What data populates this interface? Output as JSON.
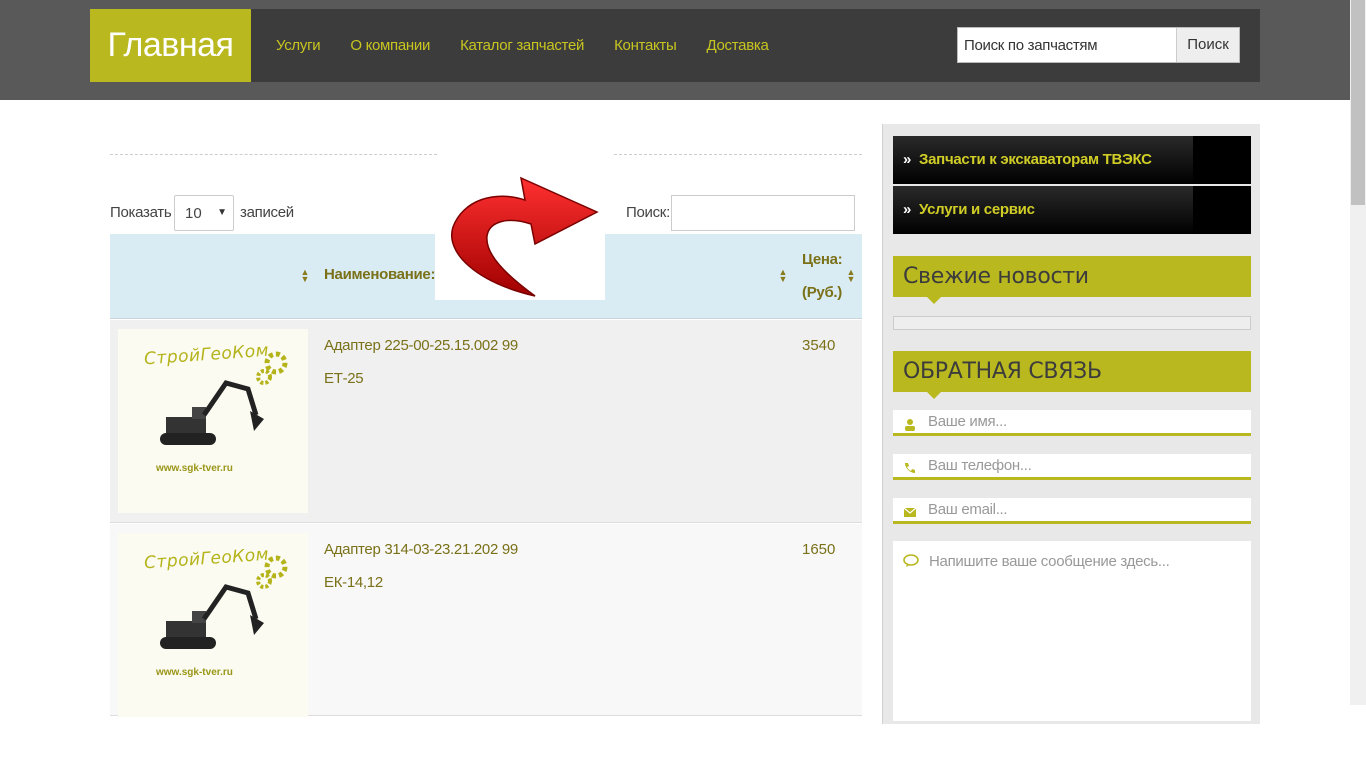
{
  "header": {
    "logo": "Главная",
    "nav": [
      "Услуги",
      "О компании",
      "Каталог запчастей",
      "Контакты",
      "Доставка"
    ],
    "search_placeholder": "Поиск по запчастям",
    "search_button": "Поиск"
  },
  "table_controls": {
    "show_label": "Показать",
    "page_length": "10",
    "entries_label": "записей",
    "filter_label": "Поиск:"
  },
  "table": {
    "columns": [
      "",
      "Наименование:",
      "Цена:",
      "(Руб.)"
    ],
    "rows": [
      {
        "name": "Адаптер 225-00-25.15.002 99",
        "model": "ЕТ-25",
        "price": "3540",
        "image_brand": "СтройГеоКом",
        "image_url": "www.sgk-tver.ru"
      },
      {
        "name": "Адаптер 314-03-23.21.202 99",
        "model": "ЕК-14,12",
        "price": "1650",
        "image_brand": "СтройГеоКом",
        "image_url": "www.sgk-tver.ru"
      }
    ]
  },
  "sidebar": {
    "categories": [
      "Запчасти к экскаваторам ТВЭКС",
      "Услуги и сервис"
    ],
    "news_title": "Свежие новости",
    "feedback_title": "ОБРАТНАЯ СВЯЗЬ",
    "fields": {
      "name_placeholder": "Ваше имя...",
      "phone_placeholder": "Ваш телефон...",
      "email_placeholder": "Ваш email...",
      "message_placeholder": "Напишите ваше сообщение здесь..."
    }
  },
  "colors": {
    "accent": "#b9b81f",
    "header_bg": "#3c3c3c",
    "text_olive": "#7a7118",
    "table_head": "#d9ebf3"
  }
}
